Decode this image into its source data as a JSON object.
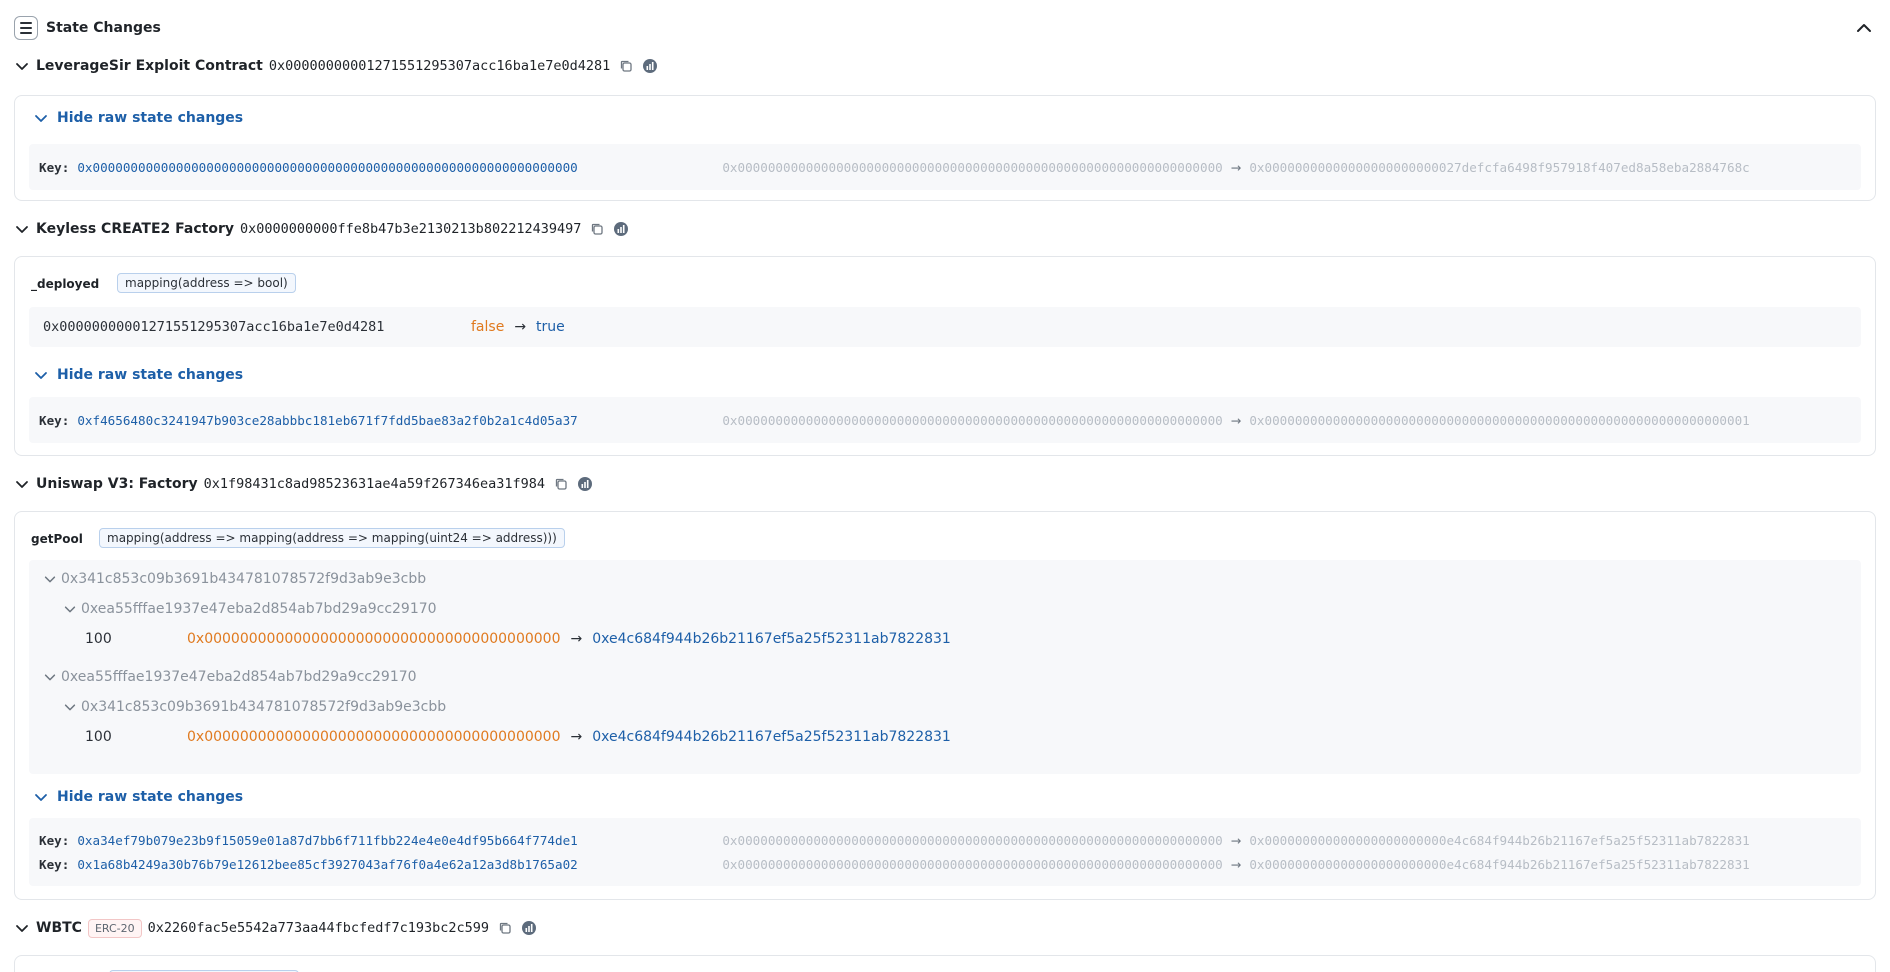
{
  "header": {
    "title": "State Changes"
  },
  "contracts": [
    {
      "name": "LeverageSir Exploit Contract",
      "address": "0x00000000001271551295307acc16ba1e7e0d4281",
      "raw_toggle": "Hide raw state changes",
      "raw": [
        {
          "label": "Key:",
          "key": "0x0000000000000000000000000000000000000000000000000000000000000000",
          "old": "0x0000000000000000000000000000000000000000000000000000000000000000",
          "new": "0x00000000000000000000000027defcfa6498f957918f407ed8a58eba2884768c"
        }
      ]
    },
    {
      "name": "Keyless CREATE2 Factory",
      "address": "0x0000000000ffe8b47b3e2130213b802212439497",
      "var_name": "_deployed",
      "var_type": "mapping(address => bool)",
      "var_key": "0x00000000001271551295307acc16ba1e7e0d4281",
      "var_old": "false",
      "var_new": "true",
      "raw_toggle": "Hide raw state changes",
      "raw": [
        {
          "label": "Key:",
          "key": "0xf4656480c3241947b903ce28abbbc181eb671f7fdd5bae83a2f0b2a1c4d05a37",
          "old": "0x0000000000000000000000000000000000000000000000000000000000000000",
          "new": "0x0000000000000000000000000000000000000000000000000000000000000001"
        }
      ]
    },
    {
      "name": "Uniswap V3: Factory",
      "address": "0x1f98431c8ad98523631ae4a59f267346ea31f984",
      "var_name": "getPool",
      "var_type": "mapping(address => mapping(address => mapping(uint24 => address)))",
      "tree": [
        {
          "key": "0x341c853c09b3691b434781078572f9d3ab9e3cbb",
          "child": "0xea55fffae1937e47eba2d854ab7bd29a9cc29170",
          "fee": "100",
          "old": "0x0000000000000000000000000000000000000000",
          "new": "0xe4c684f944b26b21167ef5a25f52311ab7822831"
        },
        {
          "key": "0xea55fffae1937e47eba2d854ab7bd29a9cc29170",
          "child": "0x341c853c09b3691b434781078572f9d3ab9e3cbb",
          "fee": "100",
          "old": "0x0000000000000000000000000000000000000000",
          "new": "0xe4c684f944b26b21167ef5a25f52311ab7822831"
        }
      ],
      "raw_toggle": "Hide raw state changes",
      "raw": [
        {
          "label": "Key:",
          "key": "0xa34ef79b079e23b9f15059e01a87d7bb6f711fbb224e4e0e4df95b664f774de1",
          "old": "0x0000000000000000000000000000000000000000000000000000000000000000",
          "new": "0x000000000000000000000000e4c684f944b26b21167ef5a25f52311ab7822831"
        },
        {
          "label": "Key:",
          "key": "0x1a68b4249a30b76b79e12612bee85cf3927043af76f0a4e62a12a3d8b1765a02",
          "old": "0x0000000000000000000000000000000000000000000000000000000000000000",
          "new": "0x000000000000000000000000e4c684f944b26b21167ef5a25f52311ab7822831"
        }
      ]
    },
    {
      "name": "WBTC",
      "badge": "ERC-20",
      "address": "0x2260fac5e5542a773aa44fbcfedf7c193bc2c599"
    }
  ],
  "arrow_glyph": "→",
  "colors": {
    "link": "#1d5fa8",
    "old_value": "#e07a1f",
    "muted": "#b7bdc5"
  },
  "icons": [
    "menu-icon",
    "chevron-up-icon",
    "chevron-down-icon",
    "copy-icon",
    "explorer-icon",
    "arrow-right-icon"
  ]
}
